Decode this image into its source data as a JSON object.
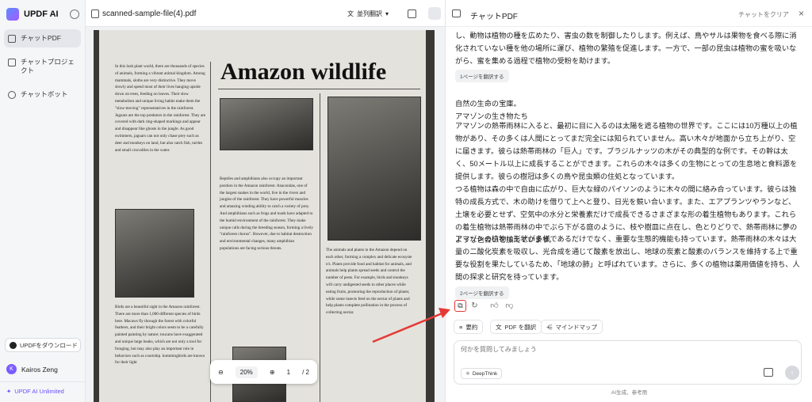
{
  "app": {
    "name": "UPDF AI"
  },
  "sidebar": {
    "items": [
      {
        "label": "チャットPDF",
        "active": true
      },
      {
        "label": "チャットプロジェクト",
        "active": false
      },
      {
        "label": "チャットボット",
        "active": false
      }
    ],
    "download_label": "UPDFをダウンロード",
    "user_name": "Kairos Zeng",
    "user_initial": "K",
    "plan_label": "UPDF AI Unlimited"
  },
  "viewer": {
    "file_name": "scanned-sample-file(4).pdf",
    "translate_label": "並列翻訳",
    "zoom": "20%",
    "page_current": "1",
    "page_total": "/ 2",
    "doc": {
      "headline": "Amazon wildlife",
      "col1_top": "In this lush plant world, there are thousands of species of animals, forming a vibrant animal kingdom. Among mammals, sloths are very distinctive. They move slowly and spend most of their lives hanging upside down on trees, feeding on leaves. Their slow metabolism and unique living habits make them the \"slow-moving\" representatives in the rainforest. Jaguars are the top predators in the rainforest. They are covered with dark ring-shaped markings and appear and disappear like ghosts in the jungle. As good swimmers, jaguars can not only chase prey such as deer and monkeys on land, but also catch fish, turtles and small crocodiles in the water.",
      "col1_bottom": "Birds are a beautiful sight in the Amazon rainforest. There are more than 1,000 different species of birds here. Macaws fly through the forest with colorful feathers, and their bright colors seem to be a carefully painted painting by nature; toucans have exaggerated and unique large beaks, which are not only a tool for foraging, but may also play an important role in behaviors such as courtship. hummingbirds are known for their light",
      "col2": "Reptiles and amphibians also occupy an important position in the Amazon rainforest. Anacondas, one of the largest snakes in the world, live in the rivers and jungles of the rainforest. They have powerful muscles and amazing winding ability to catch a variety of prey. And amphibians such as frogs and toads have adapted to the humid environment of the rainforest. They make unique calls during the breeding season, forming a lively \"rainforest chorus\". However, due to habitat destruction and environmental changes, many amphibian populations are facing serious threats.",
      "col3": "The animals and plants in the Amazon depend on each other, forming a complex and delicate ecosyste n's. Plants provide food and habitat for animals, and animals help plants spread seeds and control the number of pests. For example, birds and monkeys will carry undigested seeds to other places while eating fruits, promoting the reproduction of plants; while some insects feed on the nectar of plants and help plants complete pollination in the process of collecting nectar."
    }
  },
  "chat": {
    "title": "チャットPDF",
    "clear_label": "チャットをクリア",
    "msg1": "し、動物は植物の種を広めたり、害虫の数を制御したりします。例えば、鳥やサルは果物を食べる際に消化されていない種を他の場所に運び、植物の繁殖を促進します。一方で、一部の昆虫は植物の蜜を吸いながら、蜜を集める過程で植物の受粉を助けます。",
    "chip1": "1ページを翻訳する",
    "msg2_lines": [
      "自然の生命の宝庫。",
      "アマゾンの生き物たち"
    ],
    "msg2": "アマゾンの熱帯雨林に入ると、最初に目に入るのは太陽を遮る植物の世界です。ここには10万種以上の植物があり、その多くは人間にとってまだ完全には知られていません。高い木々が地面から立ち上がり、空に届きます。彼らは熱帯雨林の「巨人」です。ブラジルナッツの木がその典型的な例です。その幹は太く、50メートル以上に成長することができます。これらの木々は多くの生物にとっての生息地と食料源を提供します。彼らの樹冠は多くの鳥や昆虫類の住処となっています。",
    "msg3": "つる植物は森の中で自由に広がり、巨大な緑のパイソンのように木々の間に絡み合っています。彼らは独特の成長方式で、木の助けを借りて上へと登り、日光を競い合います。また、エアプランツやランなど、土壌を必要とせず、空気中の水分と栄養素だけで成長できるさまざまな形の着生植物もあります。これらの着生植物は熱帯雨林の中でぶら下がる庭のように、枝や樹皿に点在し、色とりどりで、熱帯雨林に夢のような色合いを加えています。",
    "msg4": "アマゾンの植物は形状が多様であるだけでなく、重要な生態的機能も持っています。熱帯雨林の木々は大量の二酸化炭素を吸収し、光合成を通じて酸素を放出し、地球の炭素と酸素のバランスを維持する上で重要な役割を果たしているため、「地球の肺」と呼ばれています。さらに、多くの植物は薬用価値を持ち、人間の探求と研究を待っています。",
    "chip2": "2ページを翻訳する",
    "actions": {
      "summary": "要約",
      "pdf_translate": "PDF を翻訳",
      "mindmap": "マインドマップ"
    },
    "input_placeholder": "何かを質問してみましょう",
    "deepthink_label": "DeepThink",
    "footer_note": "AI生成、参考用"
  }
}
